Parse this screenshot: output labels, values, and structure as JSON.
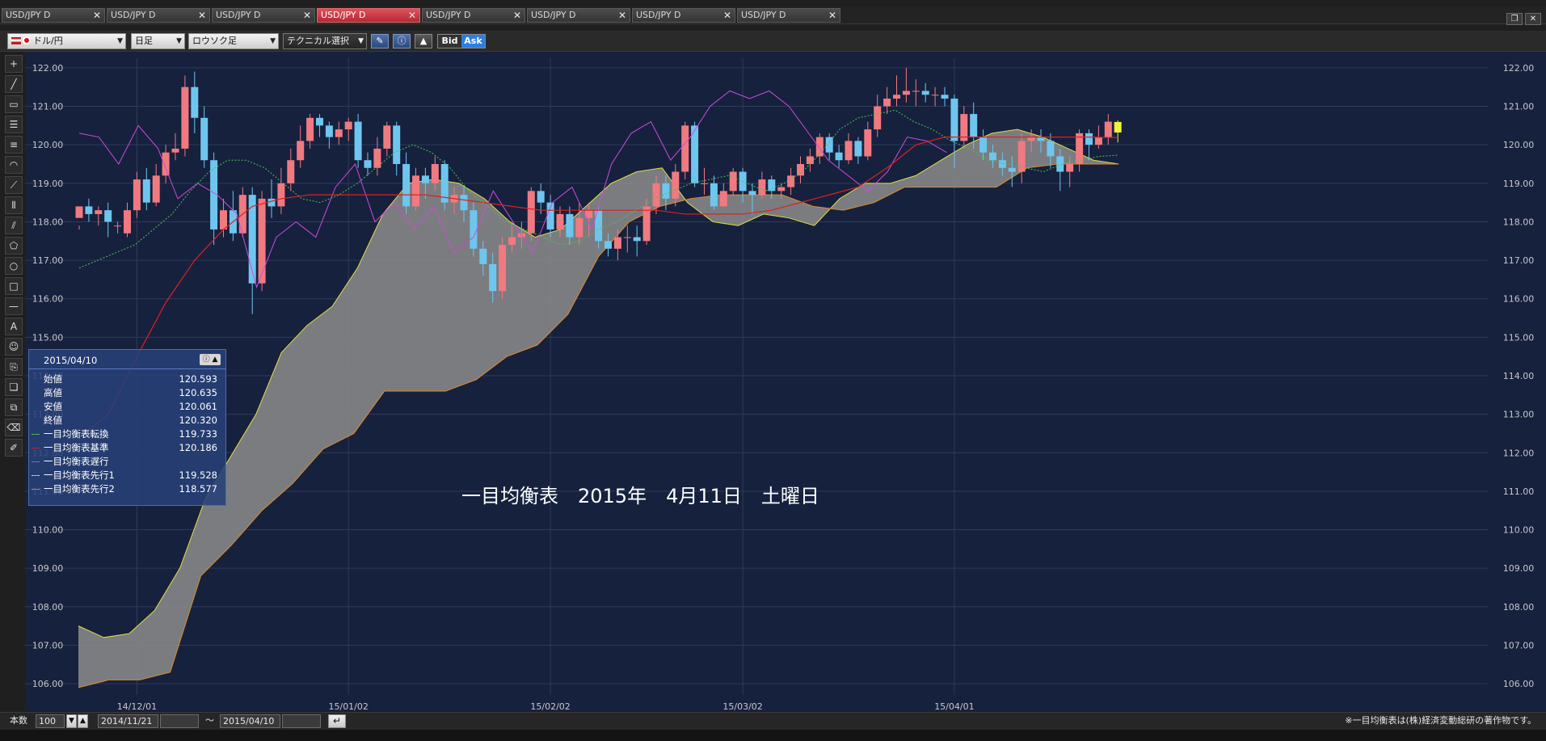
{
  "tabs": [
    {
      "label": "USD/JPY D",
      "active": false
    },
    {
      "label": "USD/JPY D",
      "active": false
    },
    {
      "label": "USD/JPY D",
      "active": false
    },
    {
      "label": "USD/JPY D",
      "active": true
    },
    {
      "label": "USD/JPY D",
      "active": false
    },
    {
      "label": "USD/JPY D",
      "active": false
    },
    {
      "label": "USD/JPY D",
      "active": false
    },
    {
      "label": "USD/JPY D",
      "active": false
    }
  ],
  "toolbar": {
    "pair": "ドル/円",
    "period": "日足",
    "chart_type": "ロウソク足",
    "technical": "テクニカル選択",
    "bid": "Bid",
    "ask": "Ask"
  },
  "info_panel": {
    "date": "2015/04/10",
    "rows": [
      {
        "label": "始値",
        "value": "120.593"
      },
      {
        "label": "高値",
        "value": "120.635"
      },
      {
        "label": "安値",
        "value": "120.061"
      },
      {
        "label": "終値",
        "value": "120.320"
      }
    ],
    "indicators": [
      {
        "label": "一目均衡表転換",
        "value": "119.733",
        "color": "#4ec24e"
      },
      {
        "label": "一目均衡表基準",
        "value": "120.186",
        "color": "#e02020"
      },
      {
        "label": "一目均衡表遅行",
        "value": "",
        "color": "#d04ad8"
      },
      {
        "label": "一目均衡表先行1",
        "value": "119.528",
        "color": "#e0e040"
      },
      {
        "label": "一目均衡表先行2",
        "value": "118.577",
        "color": "#e08a2a"
      }
    ]
  },
  "overlay_text": "一目均衡表　2015年　4月11日　土曜日",
  "status": {
    "count_label": "本数",
    "count_value": "100",
    "start_date": "2014/11/21",
    "tilde": "～",
    "end_date": "2015/04/10",
    "copyright": "※一目均衡表は(株)経済変動総研の著作物です。"
  },
  "colors": {
    "background": "#16213e",
    "bull": "#f07a80",
    "bear": "#6ec6ee",
    "cloud": "#8c8c8c",
    "tenkan": "#4ec24e",
    "kijun": "#e02020",
    "chikou": "#d04ad8",
    "span_a": "#e0e040",
    "span_b": "#e08a2a"
  },
  "chart_data": {
    "type": "line",
    "instrument": "USD/JPY D",
    "ylim": [
      105.75,
      122.25
    ],
    "y_ticks": [
      "106.00",
      "107.00",
      "108.00",
      "109.00",
      "110.00",
      "111.00",
      "112.00",
      "113.00",
      "114.00",
      "115.00",
      "116.00",
      "117.00",
      "118.00",
      "119.00",
      "120.00",
      "121.00",
      "122.00"
    ],
    "x_ticks": [
      "14/12/01",
      "15/01/02",
      "15/02/02",
      "15/03/02",
      "15/04/01"
    ],
    "candles": [
      [
        118.1,
        118.4,
        117.9,
        117.8
      ],
      [
        118.4,
        118.2,
        118.6,
        118.0
      ],
      [
        118.2,
        118.3,
        118.4,
        117.9
      ],
      [
        118.3,
        118.0,
        118.5,
        117.6
      ],
      [
        117.9,
        117.9,
        118.0,
        117.7
      ],
      [
        117.7,
        118.3,
        118.5,
        117.6
      ],
      [
        118.3,
        119.1,
        119.3,
        118.1
      ],
      [
        119.1,
        118.5,
        119.4,
        118.3
      ],
      [
        118.5,
        119.2,
        119.5,
        118.4
      ],
      [
        119.2,
        119.8,
        120.0,
        119.0
      ],
      [
        119.8,
        119.9,
        120.3,
        119.6
      ],
      [
        119.9,
        121.5,
        121.8,
        119.7
      ],
      [
        121.5,
        120.7,
        121.9,
        120.3
      ],
      [
        120.7,
        119.6,
        121.0,
        119.4
      ],
      [
        119.6,
        117.8,
        119.8,
        117.4
      ],
      [
        117.8,
        118.3,
        118.6,
        117.6
      ],
      [
        118.3,
        117.7,
        118.8,
        117.5
      ],
      [
        117.7,
        118.7,
        118.9,
        117.6
      ],
      [
        118.7,
        116.4,
        118.9,
        115.6
      ],
      [
        116.4,
        118.6,
        118.8,
        116.2
      ],
      [
        118.6,
        118.4,
        119.1,
        118.1
      ],
      [
        118.4,
        119.0,
        119.4,
        118.2
      ],
      [
        119.0,
        119.6,
        119.9,
        118.8
      ],
      [
        119.6,
        120.1,
        120.5,
        119.4
      ],
      [
        120.1,
        120.7,
        120.8,
        119.9
      ],
      [
        120.7,
        120.5,
        120.8,
        120.2
      ],
      [
        120.5,
        120.2,
        120.6,
        119.9
      ],
      [
        120.2,
        120.4,
        120.6,
        120.0
      ],
      [
        120.4,
        120.6,
        120.7,
        120.1
      ],
      [
        120.6,
        119.6,
        120.8,
        119.4
      ],
      [
        119.6,
        119.4,
        119.8,
        119.2
      ],
      [
        119.4,
        119.9,
        120.2,
        119.2
      ],
      [
        119.9,
        120.5,
        120.6,
        119.7
      ],
      [
        120.5,
        119.5,
        120.6,
        119.2
      ],
      [
        119.5,
        118.4,
        119.8,
        118.2
      ],
      [
        118.4,
        119.2,
        119.4,
        118.3
      ],
      [
        119.2,
        119.0,
        119.4,
        118.6
      ],
      [
        119.0,
        119.5,
        119.7,
        118.8
      ],
      [
        119.5,
        118.5,
        119.6,
        118.3
      ],
      [
        118.5,
        118.7,
        118.9,
        118.2
      ],
      [
        118.7,
        118.3,
        118.9,
        118.0
      ],
      [
        118.3,
        117.3,
        118.5,
        117.1
      ],
      [
        117.3,
        116.9,
        117.5,
        116.6
      ],
      [
        116.9,
        116.2,
        117.2,
        115.9
      ],
      [
        116.2,
        117.4,
        117.6,
        116.0
      ],
      [
        117.4,
        117.6,
        117.9,
        117.2
      ],
      [
        117.6,
        117.7,
        118.0,
        117.3
      ],
      [
        117.7,
        118.8,
        118.9,
        117.5
      ],
      [
        118.8,
        118.5,
        119.0,
        118.2
      ],
      [
        118.5,
        117.8,
        118.7,
        117.6
      ],
      [
        117.8,
        118.2,
        118.4,
        117.6
      ],
      [
        118.2,
        117.6,
        118.4,
        117.4
      ],
      [
        117.6,
        118.1,
        118.5,
        117.4
      ],
      [
        118.1,
        118.3,
        118.5,
        117.6
      ],
      [
        118.3,
        117.5,
        118.4,
        117.3
      ],
      [
        117.5,
        117.3,
        117.7,
        117.1
      ],
      [
        117.3,
        117.6,
        117.8,
        117.0
      ],
      [
        117.6,
        117.6,
        117.9,
        117.2
      ],
      [
        117.6,
        117.5,
        117.9,
        117.1
      ],
      [
        117.5,
        118.4,
        118.6,
        117.4
      ],
      [
        118.4,
        119.0,
        119.2,
        118.2
      ],
      [
        119.0,
        118.6,
        119.2,
        118.3
      ],
      [
        118.6,
        119.3,
        119.5,
        118.4
      ],
      [
        119.3,
        120.5,
        120.6,
        119.1
      ],
      [
        120.5,
        119.0,
        120.6,
        118.9
      ],
      [
        119.0,
        119.0,
        119.4,
        118.7
      ],
      [
        119.0,
        118.4,
        119.2,
        118.3
      ],
      [
        118.4,
        118.8,
        119.0,
        118.4
      ],
      [
        118.8,
        119.3,
        119.4,
        118.7
      ],
      [
        119.3,
        118.8,
        119.4,
        118.5
      ],
      [
        118.8,
        118.7,
        119.0,
        118.2
      ],
      [
        118.7,
        119.1,
        119.3,
        118.6
      ],
      [
        119.1,
        118.8,
        119.2,
        118.6
      ],
      [
        118.8,
        118.9,
        119.0,
        118.6
      ],
      [
        118.9,
        119.2,
        119.4,
        118.7
      ],
      [
        119.2,
        119.5,
        119.7,
        119.0
      ],
      [
        119.5,
        119.7,
        119.9,
        119.3
      ],
      [
        119.7,
        120.2,
        120.3,
        119.5
      ],
      [
        120.2,
        119.8,
        120.3,
        119.6
      ],
      [
        119.8,
        119.6,
        120.0,
        119.4
      ],
      [
        119.6,
        120.1,
        120.3,
        119.5
      ],
      [
        120.1,
        119.7,
        120.2,
        119.5
      ],
      [
        119.7,
        120.4,
        120.6,
        119.6
      ],
      [
        120.4,
        121.0,
        121.3,
        120.2
      ],
      [
        121.0,
        121.2,
        121.5,
        120.8
      ],
      [
        121.2,
        121.3,
        121.8,
        121.0
      ],
      [
        121.3,
        121.4,
        122.0,
        121.1
      ],
      [
        121.4,
        121.4,
        121.7,
        121.0
      ],
      [
        121.4,
        121.3,
        121.6,
        121.1
      ],
      [
        121.3,
        121.3,
        121.5,
        121.0
      ],
      [
        121.3,
        121.2,
        121.5,
        121.0
      ],
      [
        121.2,
        120.1,
        121.3,
        119.4
      ],
      [
        120.1,
        120.8,
        121.0,
        119.9
      ],
      [
        120.8,
        120.2,
        121.1,
        119.9
      ],
      [
        120.2,
        119.8,
        120.4,
        119.6
      ],
      [
        119.8,
        119.6,
        120.0,
        119.4
      ],
      [
        119.6,
        119.4,
        119.8,
        119.2
      ],
      [
        119.4,
        119.3,
        119.7,
        118.9
      ],
      [
        119.3,
        120.1,
        120.3,
        119.0
      ],
      [
        120.1,
        120.2,
        120.4,
        119.8
      ],
      [
        120.2,
        120.1,
        120.4,
        119.8
      ],
      [
        120.1,
        119.7,
        120.3,
        119.4
      ],
      [
        119.7,
        119.3,
        119.9,
        118.8
      ],
      [
        119.3,
        119.5,
        119.7,
        118.9
      ],
      [
        119.5,
        120.3,
        120.4,
        119.3
      ],
      [
        120.3,
        120.0,
        120.4,
        119.6
      ],
      [
        120.0,
        120.2,
        120.5,
        119.9
      ],
      [
        120.2,
        120.6,
        120.8,
        120.0
      ],
      [
        120.593,
        120.32,
        120.635,
        120.061
      ]
    ],
    "series": [
      {
        "name": "一目均衡表転換",
        "color": "#4ec24e",
        "values": [
          116.8,
          117.0,
          117.2,
          117.4,
          117.8,
          118.2,
          118.8,
          119.3,
          119.6,
          119.6,
          119.4,
          119.0,
          118.6,
          118.5,
          118.7,
          119.0,
          119.4,
          119.8,
          120.0,
          119.8,
          119.4,
          118.8,
          118.4,
          118.0,
          117.8,
          117.6,
          117.4,
          117.5,
          117.8,
          118.0,
          118.3,
          118.6,
          118.8,
          119.0,
          119.1,
          119.2,
          119.0,
          118.8,
          119.0,
          119.3,
          119.8,
          120.4,
          120.7,
          120.8,
          120.9,
          120.6,
          120.4,
          120.1,
          119.9,
          119.6,
          119.5,
          119.4,
          119.3,
          119.5,
          119.6,
          119.7,
          119.73
        ]
      },
      {
        "name": "一目均衡表基準",
        "color": "#e02020",
        "values": [
          112.4,
          113.0,
          114.5,
          115.9,
          117.0,
          117.8,
          118.4,
          118.6,
          118.7,
          118.7,
          118.7,
          118.7,
          118.7,
          118.6,
          118.5,
          118.4,
          118.3,
          118.3,
          118.3,
          118.3,
          118.3,
          118.2,
          118.2,
          118.2,
          118.3,
          118.5,
          118.7,
          118.9,
          119.4,
          120.0,
          120.2,
          120.2,
          120.2,
          120.2,
          120.2,
          120.2,
          120.186
        ]
      },
      {
        "name": "一目均衡表遅行",
        "color": "#d04ad8",
        "values": [
          120.3,
          120.2,
          119.5,
          120.5,
          119.9,
          118.6,
          119.0,
          118.7,
          118.2,
          116.3,
          117.6,
          118.0,
          117.6,
          118.9,
          119.5,
          118.0,
          118.5,
          117.8,
          118.4,
          117.2,
          117.6,
          118.8,
          118.0,
          117.2,
          118.5,
          118.9,
          117.8,
          119.5,
          120.3,
          120.6,
          119.6,
          120.2,
          121.0,
          121.4,
          121.2,
          121.4,
          121.0,
          120.3,
          119.6,
          119.2,
          118.8,
          119.3,
          120.2,
          120.1,
          119.8
        ]
      },
      {
        "name": "一目均衡表先行1",
        "color": "#e0e040",
        "values": [
          107.5,
          107.2,
          107.3,
          107.9,
          109.0,
          110.8,
          111.9,
          113.0,
          114.6,
          115.3,
          115.8,
          116.8,
          118.2,
          119.0,
          119.1,
          119.0,
          118.6,
          118.0,
          117.6,
          117.8,
          118.4,
          119.0,
          119.3,
          119.4,
          118.5,
          118.0,
          117.9,
          118.2,
          118.1,
          117.9,
          118.6,
          119.0,
          119.0,
          119.2,
          119.6,
          120.0,
          120.3,
          120.4,
          120.2,
          119.9,
          119.6,
          119.5
        ]
      },
      {
        "name": "一目均衡表先行2",
        "color": "#e08a2a",
        "values": [
          105.9,
          106.1,
          106.1,
          106.3,
          108.8,
          109.6,
          110.5,
          111.2,
          112.1,
          112.5,
          113.6,
          113.6,
          113.6,
          113.9,
          114.5,
          114.8,
          115.6,
          117.1,
          118.0,
          118.4,
          118.6,
          118.7,
          118.7,
          118.7,
          118.4,
          118.3,
          118.5,
          118.9,
          118.9,
          118.9,
          118.9,
          119.4,
          119.5,
          119.5,
          119.5
        ]
      }
    ]
  }
}
